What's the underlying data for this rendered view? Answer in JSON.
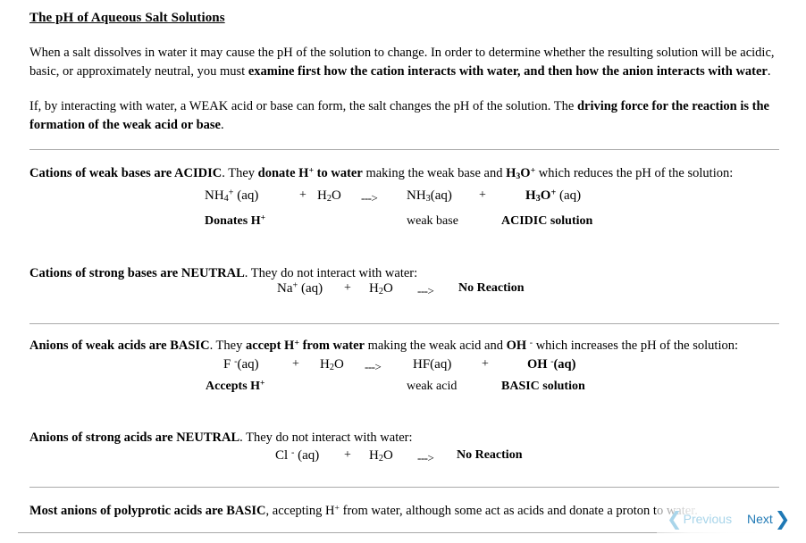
{
  "document": {
    "title": "The pH of Aqueous Salt Solutions",
    "intro_paragraphs": [
      {
        "runs": [
          {
            "text": "When a salt dissolves in water it may cause the pH of the solution to change. In order to determine whether the resulting solution will be acidic, basic, or approximately neutral, you must ",
            "bold": false
          },
          {
            "text": "examine first how the cation interacts with water, and then how the anion interacts with water",
            "bold": true
          },
          {
            "text": ".",
            "bold": false
          }
        ]
      },
      {
        "runs": [
          {
            "text": "If, by interacting with water, a WEAK acid or base can form, the salt changes the pH of the solution. The ",
            "bold": false
          },
          {
            "text": "driving force for the reaction is the formation of the weak acid or base",
            "bold": true
          },
          {
            "text": ".",
            "bold": false
          }
        ]
      }
    ],
    "sections": [
      {
        "id": "cations-weak-bases",
        "heading_html": "Cations of weak bases are ACIDIC",
        "heading_rest_1": ". They ",
        "heading_bold_2": "donate H",
        "heading_sup_2": "+",
        "heading_bold_3": " to water",
        "heading_rest_2": " making the weak base and ",
        "heading_formula": "H3O+",
        "heading_rest_3": " which reduces the pH of the solution:",
        "equation": {
          "reactant1": "NH4+ (aq)",
          "plus1": "+",
          "reactant2": "H2O",
          "arrow": "--->",
          "product1": "NH3(aq)",
          "plus2": "+",
          "product2": "H3O+ (aq)"
        },
        "labels": {
          "left": "Donates H+",
          "middle": "weak base",
          "right": "ACIDIC solution"
        }
      },
      {
        "id": "cations-strong-bases",
        "heading_bold": "Cations of strong bases are NEUTRAL",
        "heading_rest": ". They do not interact with water:",
        "equation": {
          "reactant1": "Na+ (aq)",
          "plus1": "+",
          "reactant2": "H2O",
          "arrow": "--->",
          "product1": "No Reaction"
        }
      },
      {
        "id": "anions-weak-acids",
        "heading_bold": "Anions of weak acids are BASIC",
        "heading_rest_1": ". They ",
        "heading_bold_2": "accept H",
        "heading_sup_2": "+",
        "heading_bold_3": " from water",
        "heading_rest_2": " making the weak acid and ",
        "heading_formula": "OH -",
        "heading_rest_3": " which increases the pH of the solution:",
        "equation": {
          "reactant1": "F -(aq)",
          "plus1": "+",
          "reactant2": "H2O",
          "arrow": "--->",
          "product1": "HF(aq)",
          "plus2": "+",
          "product2": "OH -(aq)"
        },
        "labels": {
          "left": "Accepts H+",
          "middle": "weak acid",
          "right": "BASIC solution"
        }
      },
      {
        "id": "anions-strong-acids",
        "heading_bold": "Anions of strong acids are NEUTRAL",
        "heading_rest": ". They do not interact with water:",
        "equation": {
          "reactant1": "Cl -(aq)",
          "plus1": "+",
          "reactant2": "H2O",
          "arrow": "--->",
          "product1": "No Reaction"
        }
      },
      {
        "id": "polyprotic-anions",
        "heading_bold": "Most anions of polyprotic acids are BASIC",
        "heading_rest_1": ", accepting H",
        "heading_sup": "+",
        "heading_rest_2": " from water, although some act as acids and donate a proton to water."
      }
    ]
  },
  "navigation": {
    "previous_label": "Previous",
    "next_label": "Next",
    "previous_icon": "chevron-left-icon",
    "next_icon": "chevron-right-icon",
    "previous_chevron": "❮",
    "next_chevron": "❯",
    "previous_color": "#a9d5ea",
    "next_color": "#1f79b5",
    "previous_enabled": false,
    "next_enabled": true
  },
  "colors": {
    "background": "#ffffff",
    "text": "#000000",
    "divider": "#a9a9a9",
    "nav_active": "#1f79b5",
    "nav_disabled": "#a9d5ea"
  }
}
